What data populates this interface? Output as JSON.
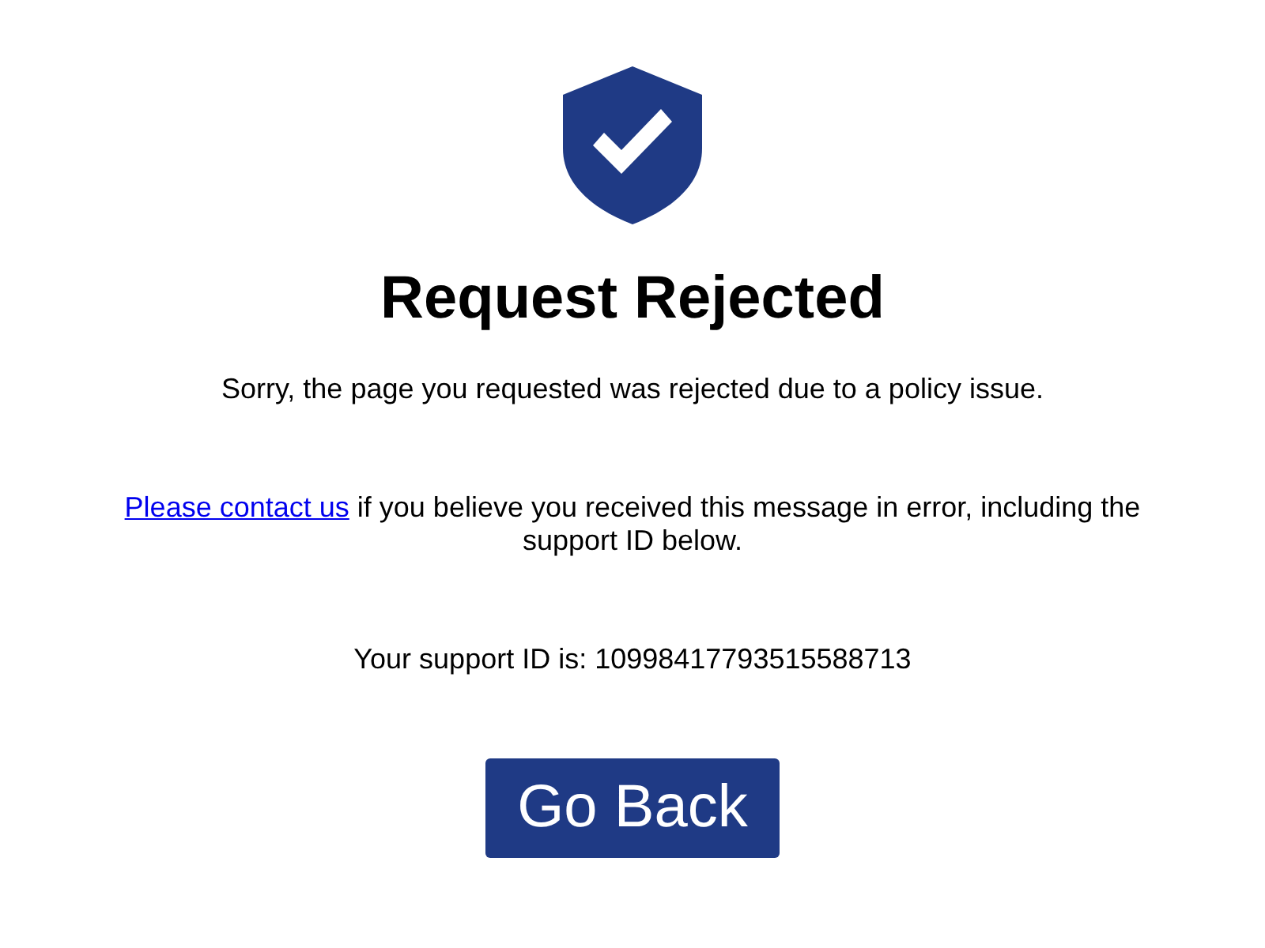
{
  "title": "Request Rejected",
  "message": "Sorry, the page you requested was rejected due to a policy issue.",
  "contact": {
    "link": "Please contact us",
    "text": "if you believe you received this message in error, including the support ID below."
  },
  "support_id": "Your support ID is: 10998417793515588713",
  "button": "Go Back"
}
